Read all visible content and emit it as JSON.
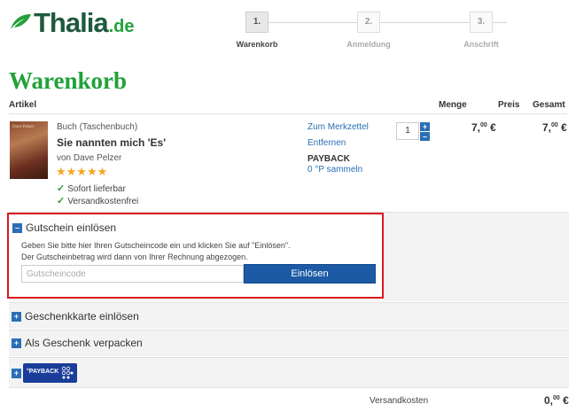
{
  "brand": {
    "name": "Thalia",
    "tld": ".de"
  },
  "steps": [
    {
      "num": "1.",
      "label": "Warenkorb",
      "active": true
    },
    {
      "num": "2.",
      "label": "Anmeldung",
      "active": false
    },
    {
      "num": "3.",
      "label": "Anschrift",
      "active": false
    }
  ],
  "page_title": "Warenkorb",
  "columns": {
    "article": "Artikel",
    "quantity": "Menge",
    "price": "Preis",
    "total": "Gesamt"
  },
  "product": {
    "cover_text": "Dave Pelzer",
    "type": "Buch (Taschenbuch)",
    "title": "Sie nannten mich 'Es'",
    "author": "von Dave Pelzer",
    "stars": "★★★★★",
    "availability": "Sofort lieferbar",
    "shipping": "Versandkostenfrei",
    "watchlist_link": "Zum Merkzettel",
    "remove_link": "Entfernen",
    "payback_label": "PAYBACK",
    "payback_points": "0 °P sammeln",
    "quantity": "1",
    "price_main": "7,",
    "price_cents": "00",
    "price_currency": "€",
    "total_main": "7,",
    "total_cents": "00",
    "total_currency": "€"
  },
  "voucher": {
    "title": "Gutschein einlösen",
    "line1": "Geben Sie bitte hier Ihren Gutscheincode ein und klicken Sie auf \"Einlösen\".",
    "line2": "Der Gutscheinbetrag wird dann von Ihrer Rechnung abgezogen.",
    "placeholder": "Gutscheincode",
    "button": "Einlösen"
  },
  "giftcard": {
    "label": "Geschenkkarte einlösen"
  },
  "giftwrap": {
    "label": "Als Geschenk verpacken"
  },
  "payback_panel": {
    "logo_text": "°PAYBACK"
  },
  "shipping_cost": {
    "label": "Versandkosten",
    "main": "0,",
    "cents": "00",
    "currency": "€"
  },
  "colors": {
    "brand_green": "#22a13b",
    "link_blue": "#2a6fb5",
    "button_blue": "#1c5aa5",
    "highlight_red": "#d9181e"
  }
}
